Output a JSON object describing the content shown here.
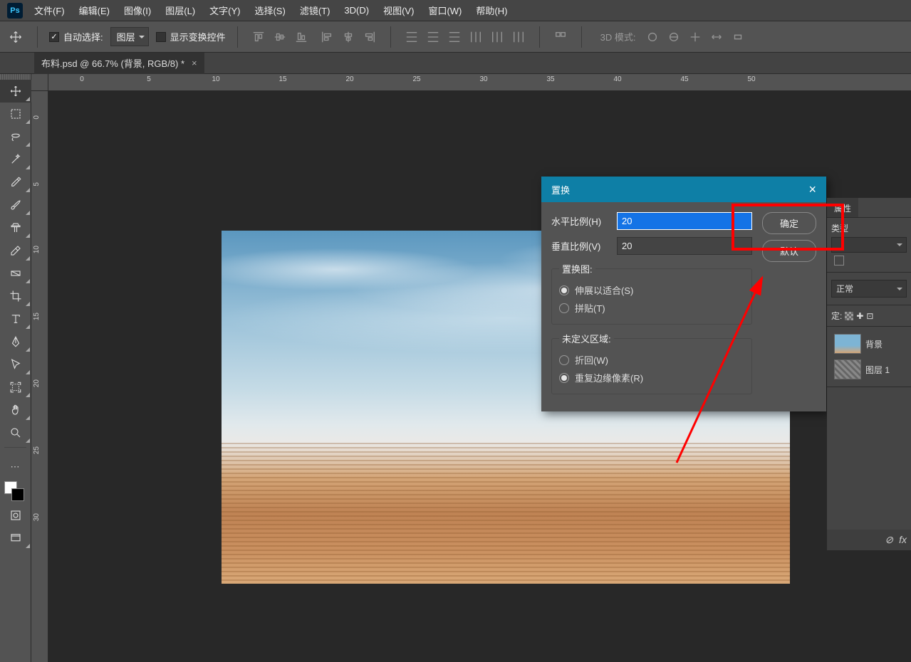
{
  "menubar": {
    "items": [
      "文件(F)",
      "编辑(E)",
      "图像(I)",
      "图层(L)",
      "文字(Y)",
      "选择(S)",
      "滤镜(T)",
      "3D(D)",
      "视图(V)",
      "窗口(W)",
      "帮助(H)"
    ]
  },
  "optionsbar": {
    "auto_select_label": "自动选择:",
    "auto_select_target": "图层",
    "show_transform_label": "显示变换控件",
    "mode3d_label": "3D 模式:"
  },
  "doctab": {
    "title": "布料.psd @ 66.7% (背景, RGB/8) *"
  },
  "ruler_h": [
    "0",
    "5",
    "10",
    "15",
    "20",
    "25",
    "30",
    "35",
    "40",
    "45",
    "50"
  ],
  "ruler_v": [
    "0",
    "5",
    "10",
    "15",
    "20",
    "25",
    "30"
  ],
  "dialog": {
    "title": "置换",
    "h_scale_label": "水平比例(H)",
    "h_scale_value": "20",
    "v_scale_label": "垂直比例(V)",
    "v_scale_value": "20",
    "displacement_map_legend": "置换图:",
    "stretch_label": "伸展以适合(S)",
    "tile_label": "拼贴(T)",
    "undefined_area_legend": "未定义区域:",
    "wrap_label": "折回(W)",
    "repeat_edge_label": "重复边缘像素(R)",
    "ok": "确定",
    "default": "默认"
  },
  "panels": {
    "properties_tab": "属性",
    "type_label": "类型",
    "normal_label": "正常",
    "lock_label": "定:",
    "layer_bg": "背景",
    "layer_1": "图层 1",
    "fx": "fx"
  },
  "colors": {
    "accent": "#0e7fa6",
    "red": "#ff0000"
  }
}
